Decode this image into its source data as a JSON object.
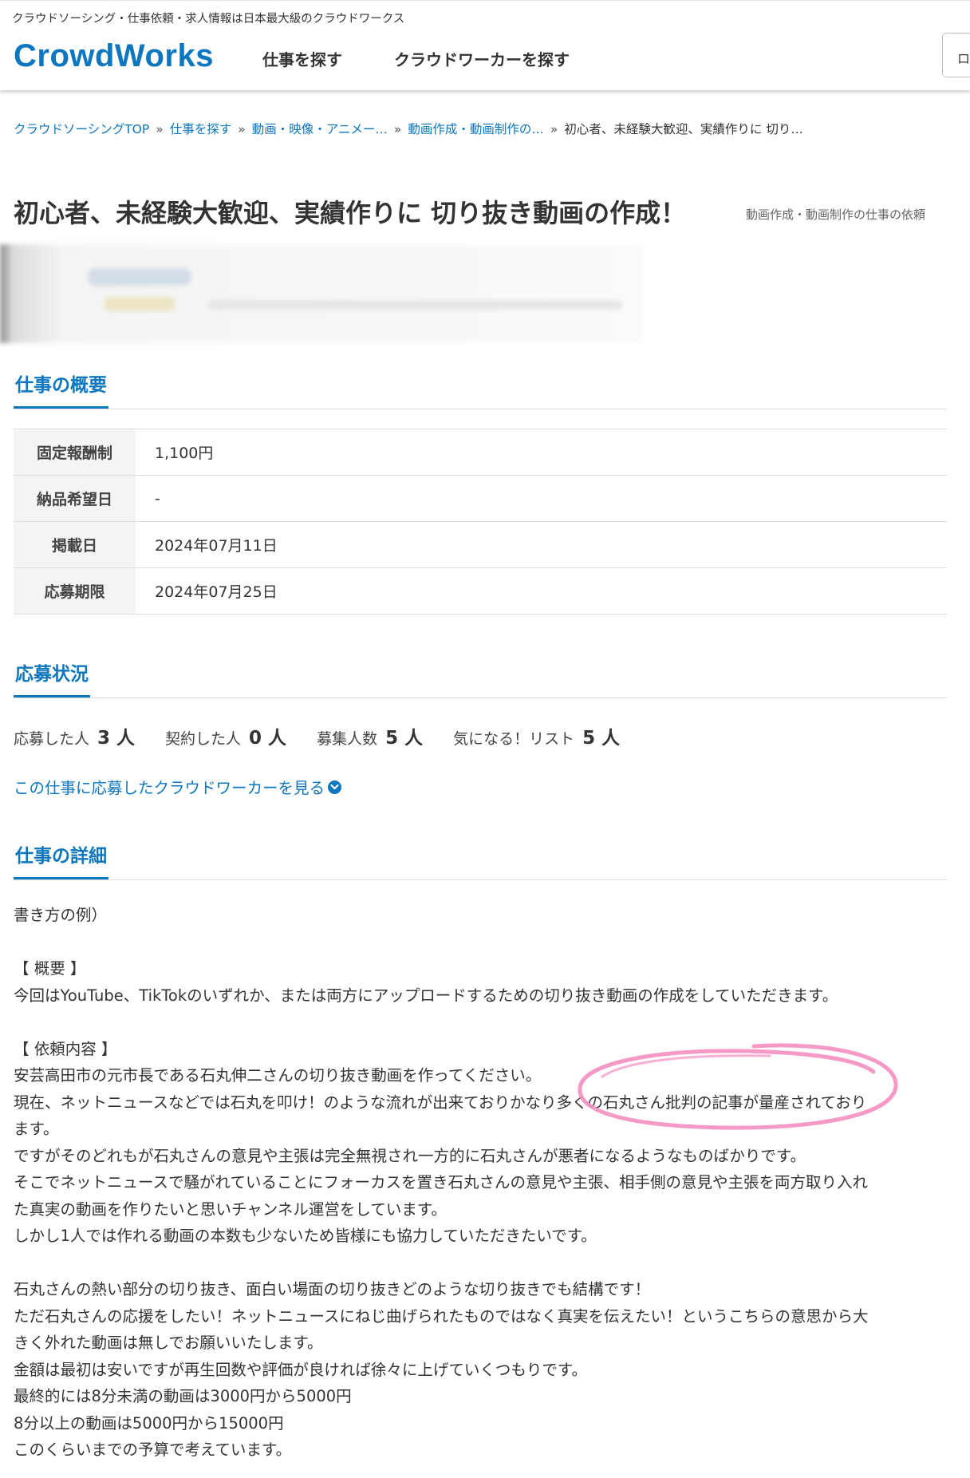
{
  "header": {
    "tagline": "クラウドソーシング・仕事依頼・求人情報は日本最大級のクラウドワークス",
    "logo": "CrowdWorks",
    "nav": [
      "仕事を探す",
      "クラウドワーカーを探す"
    ],
    "login_label": "ロ"
  },
  "breadcrumb": [
    "クラウドソーシングTOP",
    "仕事を探す",
    "動画・映像・アニメー…",
    "動画作成・動画制作の…",
    "初心者、未経験大歓迎、実績作りに 切り…"
  ],
  "breadcrumb_sep": "»",
  "title": "初心者、未経験大歓迎、実績作りに 切り抜き動画の作成！",
  "category_note": "動画作成・動画制作の仕事の依頼",
  "summary": {
    "heading": "仕事の概要",
    "rows": [
      {
        "label": "固定報酬制",
        "value": "1,100円"
      },
      {
        "label": "納品希望日",
        "value": "-"
      },
      {
        "label": "掲載日",
        "value": "2024年07月11日"
      },
      {
        "label": "応募期限",
        "value": "2024年07月25日"
      }
    ]
  },
  "status": {
    "heading": "応募状況",
    "items": [
      {
        "label": "応募した人",
        "value": "3 人"
      },
      {
        "label": "契約した人",
        "value": "0 人"
      },
      {
        "label": "募集人数",
        "value": "5 人"
      },
      {
        "label": "気になる！リスト",
        "value": "5 人"
      }
    ],
    "link": "この仕事に応募したクラウドワーカーを見る"
  },
  "details": {
    "heading": "仕事の詳細",
    "lines": [
      "書き方の例）",
      "",
      "【 概要 】",
      "今回はYouTube、TikTokのいずれか、または両方にアップロードするための切り抜き動画の作成をしていただきます。",
      "",
      "【 依頼内容 】",
      "安芸高田市の元市長である石丸伸二さんの切り抜き動画を作ってください。",
      "現在、ネットニュースなどでは石丸を叩け！のような流れが出来ておりかなり多くの石丸さん批判の記事が量産されており",
      "ます。",
      "ですがそのどれもが石丸さんの意見や主張は完全無視され一方的に石丸さんが悪者になるようなものばかりです。",
      "そこでネットニュースで騒がれていることにフォーカスを置き石丸さんの意見や主張、相手側の意見や主張を両方取り入れ",
      "た真実の動画を作りたいと思いチャンネル運営をしています。",
      "しかし1人では作れる動画の本数も少ないため皆様にも協力していただきたいです。",
      "",
      "石丸さんの熱い部分の切り抜き、面白い場面の切り抜きどのような切り抜きでも結構です！",
      "ただ石丸さんの応援をしたい！ネットニュースにねじ曲げられたものではなく真実を伝えたい！というこちらの意思から大",
      "きく外れた動画は無しでお願いいたします。",
      "金額は最初は安いですが再生回数や評価が良ければ徐々に上げていくつもりです。",
      "最終的には8分未満の動画は3000円から5000円",
      "8分以上の動画は5000円から15000円",
      "このくらいまでの予算で考えています。"
    ]
  },
  "colors": {
    "brand": "#0c76be",
    "highlight_marker": "#f48fc0"
  }
}
